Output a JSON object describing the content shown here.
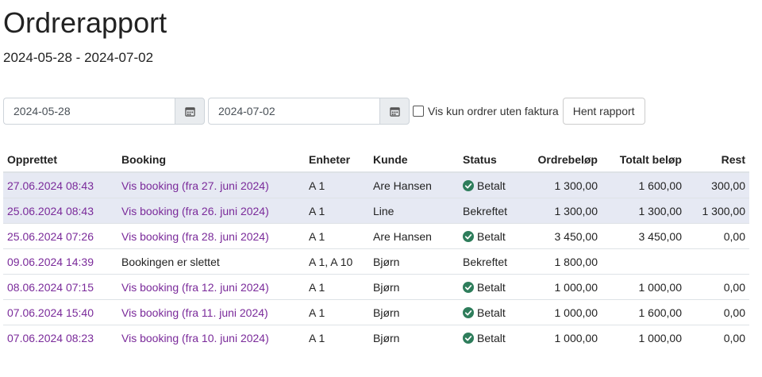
{
  "page": {
    "title": "Ordrerapport",
    "date_range": "2024-05-28 - 2024-07-02"
  },
  "filters": {
    "from_date": "2024-05-28",
    "to_date": "2024-07-02",
    "only_without_invoice_label": "Vis kun ordrer uten faktura",
    "only_without_invoice_checked": false,
    "submit_label": "Hent rapport"
  },
  "table": {
    "headers": {
      "created": "Opprettet",
      "booking": "Booking",
      "units": "Enheter",
      "customer": "Kunde",
      "status": "Status",
      "order_amount": "Ordrebeløp",
      "total_amount": "Totalt beløp",
      "rest": "Rest"
    },
    "rows": [
      {
        "created": "27.06.2024 08:43",
        "booking": "Vis booking (fra 27. juni 2024)",
        "units": "A 1",
        "customer": "Are Hansen",
        "status": "Betalt",
        "order_amount": "1 300,00",
        "total_amount": "1 600,00",
        "rest": "300,00"
      },
      {
        "created": "25.06.2024 08:43",
        "booking": "Vis booking (fra 26. juni 2024)",
        "units": "A 1",
        "customer": "Line",
        "status": "Bekreftet",
        "order_amount": "1 300,00",
        "total_amount": "1 300,00",
        "rest": "1 300,00"
      },
      {
        "created": "25.06.2024 07:26",
        "booking": "Vis booking (fra 28. juni 2024)",
        "units": "A 1",
        "customer": "Are Hansen",
        "status": "Betalt",
        "order_amount": "3 450,00",
        "total_amount": "3 450,00",
        "rest": "0,00"
      },
      {
        "created": "09.06.2024 14:39",
        "booking": "Bookingen er slettet",
        "units": "A 1, A 10",
        "customer": "Bjørn",
        "status": "Bekreftet",
        "order_amount": "1 800,00",
        "total_amount": "",
        "rest": ""
      },
      {
        "created": "08.06.2024 07:15",
        "booking": "Vis booking (fra 12. juni 2024)",
        "units": "A 1",
        "customer": "Bjørn",
        "status": "Betalt",
        "order_amount": "1 000,00",
        "total_amount": "1 000,00",
        "rest": "0,00"
      },
      {
        "created": "07.06.2024 15:40",
        "booking": "Vis booking (fra 11. juni 2024)",
        "units": "A 1",
        "customer": "Bjørn",
        "status": "Betalt",
        "order_amount": "1 000,00",
        "total_amount": "1 600,00",
        "rest": "0,00"
      },
      {
        "created": "07.06.2024 08:23",
        "booking": "Vis booking (fra 10. juni 2024)",
        "units": "A 1",
        "customer": "Bjørn",
        "status": "Betalt",
        "order_amount": "1 000,00",
        "total_amount": "1 000,00",
        "rest": "0,00"
      }
    ]
  },
  "colors": {
    "link": "#7a2a9a",
    "paid_icon": "#2e7d5b",
    "highlight_row": "#e6e9f3"
  },
  "icons": {
    "calendar": "calendar-icon",
    "paid": "check-circle-icon"
  }
}
